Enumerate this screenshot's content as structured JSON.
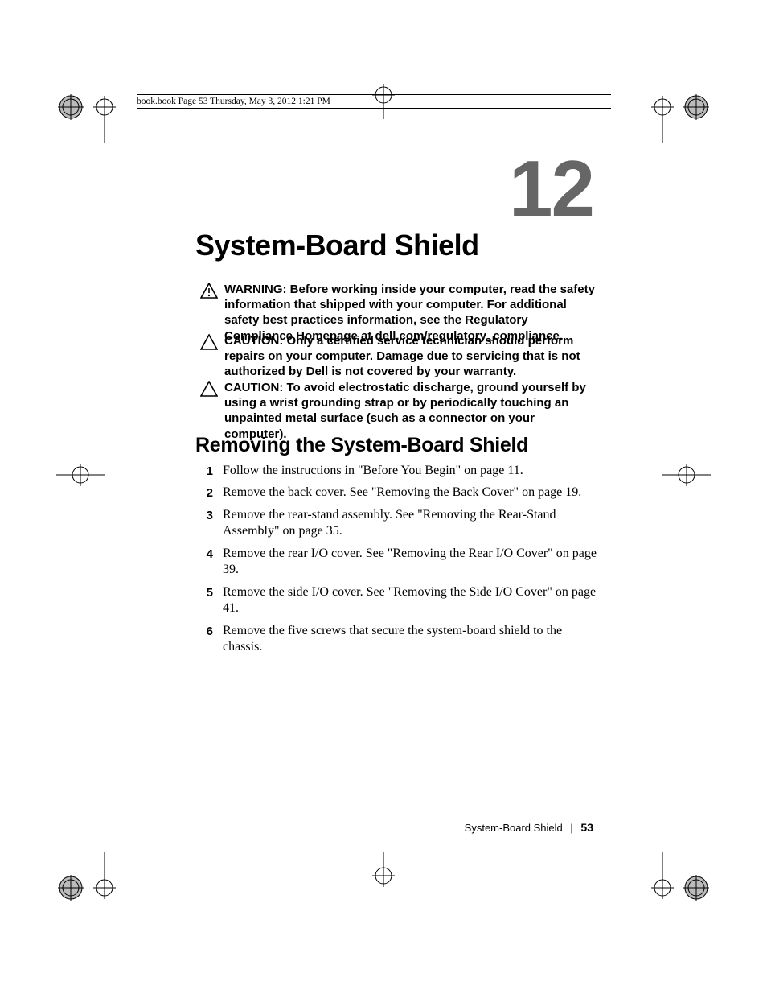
{
  "header": {
    "slugline": "book.book  Page 53  Thursday, May 3, 2012  1:21 PM"
  },
  "chapter": {
    "number": "12",
    "title": "System-Board Shield"
  },
  "admonitions": [
    {
      "icon": "warning-icon",
      "label": "WARNING: ",
      "text": "Before working inside your computer, read the safety information that shipped with your computer. For additional safety best practices information, see the Regulatory Compliance Homepage at dell.com/regulatory_compliance."
    },
    {
      "icon": "caution-icon",
      "label": "CAUTION: ",
      "text": "Only a certified service technician should perform repairs on your computer. Damage due to servicing that is not authorized by Dell is not covered by your warranty."
    },
    {
      "icon": "caution-icon",
      "label": "CAUTION: ",
      "text": "To avoid electrostatic discharge, ground yourself by using a wrist grounding strap or by periodically touching an unpainted metal surface (such as a connector on your computer)."
    }
  ],
  "section": {
    "heading": "Removing the System-Board Shield",
    "steps": [
      {
        "n": "1",
        "t": "Follow the instructions in \"Before You Begin\" on page 11."
      },
      {
        "n": "2",
        "t": "Remove the back cover. See \"Removing the Back Cover\" on page 19."
      },
      {
        "n": "3",
        "t": "Remove the rear-stand assembly. See \"Removing the Rear-Stand Assembly\" on page 35."
      },
      {
        "n": "4",
        "t": "Remove the rear I/O cover. See \"Removing the Rear I/O Cover\" on page 39."
      },
      {
        "n": "5",
        "t": "Remove the side I/O cover. See \"Removing the Side I/O Cover\" on page 41."
      },
      {
        "n": "6",
        "t": "Remove the five screws that secure the system-board shield to the chassis."
      }
    ]
  },
  "footer": {
    "running_title": "System-Board Shield",
    "separator": "|",
    "page_number": "53"
  }
}
